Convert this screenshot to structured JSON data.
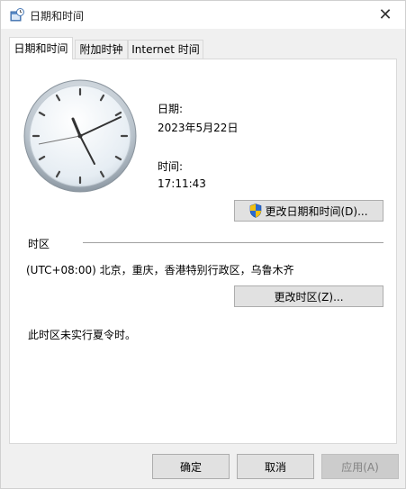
{
  "window": {
    "title": "日期和时间"
  },
  "tabs": [
    {
      "label": "日期和时间"
    },
    {
      "label": "附加时钟"
    },
    {
      "label": "Internet 时间"
    }
  ],
  "datetime": {
    "date_label": "日期:",
    "date_value": "2023年5月22日",
    "time_label": "时间:",
    "time_value": "17:11:43",
    "change_button": "更改日期和时间(D)..."
  },
  "timezone": {
    "section_label": "时区",
    "value": "(UTC+08:00) 北京，重庆，香港特别行政区，乌鲁木齐",
    "change_button": "更改时区(Z)...",
    "dst_note": "此时区未实行夏令时。"
  },
  "footer": {
    "ok": "确定",
    "cancel": "取消",
    "apply": "应用(A)"
  },
  "icons": {
    "window": "datetime-app-icon",
    "close": "close-icon",
    "shield": "uac-shield-icon"
  },
  "colors": {
    "accent_shield_blue": "#2a6bd1",
    "accent_shield_yellow": "#f2c10f",
    "disabled_text": "#838383"
  }
}
